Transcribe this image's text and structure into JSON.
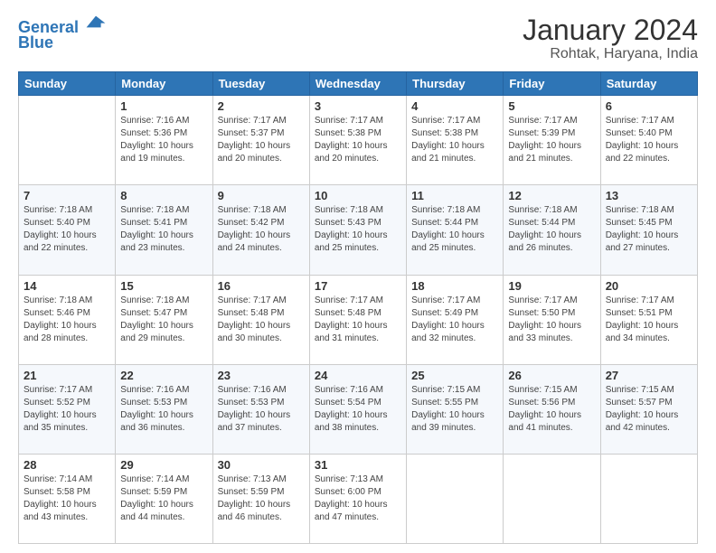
{
  "header": {
    "logo_line1": "General",
    "logo_line2": "Blue",
    "title": "January 2024",
    "subtitle": "Rohtak, Haryana, India"
  },
  "calendar": {
    "days_of_week": [
      "Sunday",
      "Monday",
      "Tuesday",
      "Wednesday",
      "Thursday",
      "Friday",
      "Saturday"
    ],
    "weeks": [
      [
        {
          "day": "",
          "sunrise": "",
          "sunset": "",
          "daylight": ""
        },
        {
          "day": "1",
          "sunrise": "Sunrise: 7:16 AM",
          "sunset": "Sunset: 5:36 PM",
          "daylight": "Daylight: 10 hours and 19 minutes."
        },
        {
          "day": "2",
          "sunrise": "Sunrise: 7:17 AM",
          "sunset": "Sunset: 5:37 PM",
          "daylight": "Daylight: 10 hours and 20 minutes."
        },
        {
          "day": "3",
          "sunrise": "Sunrise: 7:17 AM",
          "sunset": "Sunset: 5:38 PM",
          "daylight": "Daylight: 10 hours and 20 minutes."
        },
        {
          "day": "4",
          "sunrise": "Sunrise: 7:17 AM",
          "sunset": "Sunset: 5:38 PM",
          "daylight": "Daylight: 10 hours and 21 minutes."
        },
        {
          "day": "5",
          "sunrise": "Sunrise: 7:17 AM",
          "sunset": "Sunset: 5:39 PM",
          "daylight": "Daylight: 10 hours and 21 minutes."
        },
        {
          "day": "6",
          "sunrise": "Sunrise: 7:17 AM",
          "sunset": "Sunset: 5:40 PM",
          "daylight": "Daylight: 10 hours and 22 minutes."
        }
      ],
      [
        {
          "day": "7",
          "sunrise": "Sunrise: 7:18 AM",
          "sunset": "Sunset: 5:40 PM",
          "daylight": "Daylight: 10 hours and 22 minutes."
        },
        {
          "day": "8",
          "sunrise": "Sunrise: 7:18 AM",
          "sunset": "Sunset: 5:41 PM",
          "daylight": "Daylight: 10 hours and 23 minutes."
        },
        {
          "day": "9",
          "sunrise": "Sunrise: 7:18 AM",
          "sunset": "Sunset: 5:42 PM",
          "daylight": "Daylight: 10 hours and 24 minutes."
        },
        {
          "day": "10",
          "sunrise": "Sunrise: 7:18 AM",
          "sunset": "Sunset: 5:43 PM",
          "daylight": "Daylight: 10 hours and 25 minutes."
        },
        {
          "day": "11",
          "sunrise": "Sunrise: 7:18 AM",
          "sunset": "Sunset: 5:44 PM",
          "daylight": "Daylight: 10 hours and 25 minutes."
        },
        {
          "day": "12",
          "sunrise": "Sunrise: 7:18 AM",
          "sunset": "Sunset: 5:44 PM",
          "daylight": "Daylight: 10 hours and 26 minutes."
        },
        {
          "day": "13",
          "sunrise": "Sunrise: 7:18 AM",
          "sunset": "Sunset: 5:45 PM",
          "daylight": "Daylight: 10 hours and 27 minutes."
        }
      ],
      [
        {
          "day": "14",
          "sunrise": "Sunrise: 7:18 AM",
          "sunset": "Sunset: 5:46 PM",
          "daylight": "Daylight: 10 hours and 28 minutes."
        },
        {
          "day": "15",
          "sunrise": "Sunrise: 7:18 AM",
          "sunset": "Sunset: 5:47 PM",
          "daylight": "Daylight: 10 hours and 29 minutes."
        },
        {
          "day": "16",
          "sunrise": "Sunrise: 7:17 AM",
          "sunset": "Sunset: 5:48 PM",
          "daylight": "Daylight: 10 hours and 30 minutes."
        },
        {
          "day": "17",
          "sunrise": "Sunrise: 7:17 AM",
          "sunset": "Sunset: 5:48 PM",
          "daylight": "Daylight: 10 hours and 31 minutes."
        },
        {
          "day": "18",
          "sunrise": "Sunrise: 7:17 AM",
          "sunset": "Sunset: 5:49 PM",
          "daylight": "Daylight: 10 hours and 32 minutes."
        },
        {
          "day": "19",
          "sunrise": "Sunrise: 7:17 AM",
          "sunset": "Sunset: 5:50 PM",
          "daylight": "Daylight: 10 hours and 33 minutes."
        },
        {
          "day": "20",
          "sunrise": "Sunrise: 7:17 AM",
          "sunset": "Sunset: 5:51 PM",
          "daylight": "Daylight: 10 hours and 34 minutes."
        }
      ],
      [
        {
          "day": "21",
          "sunrise": "Sunrise: 7:17 AM",
          "sunset": "Sunset: 5:52 PM",
          "daylight": "Daylight: 10 hours and 35 minutes."
        },
        {
          "day": "22",
          "sunrise": "Sunrise: 7:16 AM",
          "sunset": "Sunset: 5:53 PM",
          "daylight": "Daylight: 10 hours and 36 minutes."
        },
        {
          "day": "23",
          "sunrise": "Sunrise: 7:16 AM",
          "sunset": "Sunset: 5:53 PM",
          "daylight": "Daylight: 10 hours and 37 minutes."
        },
        {
          "day": "24",
          "sunrise": "Sunrise: 7:16 AM",
          "sunset": "Sunset: 5:54 PM",
          "daylight": "Daylight: 10 hours and 38 minutes."
        },
        {
          "day": "25",
          "sunrise": "Sunrise: 7:15 AM",
          "sunset": "Sunset: 5:55 PM",
          "daylight": "Daylight: 10 hours and 39 minutes."
        },
        {
          "day": "26",
          "sunrise": "Sunrise: 7:15 AM",
          "sunset": "Sunset: 5:56 PM",
          "daylight": "Daylight: 10 hours and 41 minutes."
        },
        {
          "day": "27",
          "sunrise": "Sunrise: 7:15 AM",
          "sunset": "Sunset: 5:57 PM",
          "daylight": "Daylight: 10 hours and 42 minutes."
        }
      ],
      [
        {
          "day": "28",
          "sunrise": "Sunrise: 7:14 AM",
          "sunset": "Sunset: 5:58 PM",
          "daylight": "Daylight: 10 hours and 43 minutes."
        },
        {
          "day": "29",
          "sunrise": "Sunrise: 7:14 AM",
          "sunset": "Sunset: 5:59 PM",
          "daylight": "Daylight: 10 hours and 44 minutes."
        },
        {
          "day": "30",
          "sunrise": "Sunrise: 7:13 AM",
          "sunset": "Sunset: 5:59 PM",
          "daylight": "Daylight: 10 hours and 46 minutes."
        },
        {
          "day": "31",
          "sunrise": "Sunrise: 7:13 AM",
          "sunset": "Sunset: 6:00 PM",
          "daylight": "Daylight: 10 hours and 47 minutes."
        },
        {
          "day": "",
          "sunrise": "",
          "sunset": "",
          "daylight": ""
        },
        {
          "day": "",
          "sunrise": "",
          "sunset": "",
          "daylight": ""
        },
        {
          "day": "",
          "sunrise": "",
          "sunset": "",
          "daylight": ""
        }
      ]
    ]
  }
}
